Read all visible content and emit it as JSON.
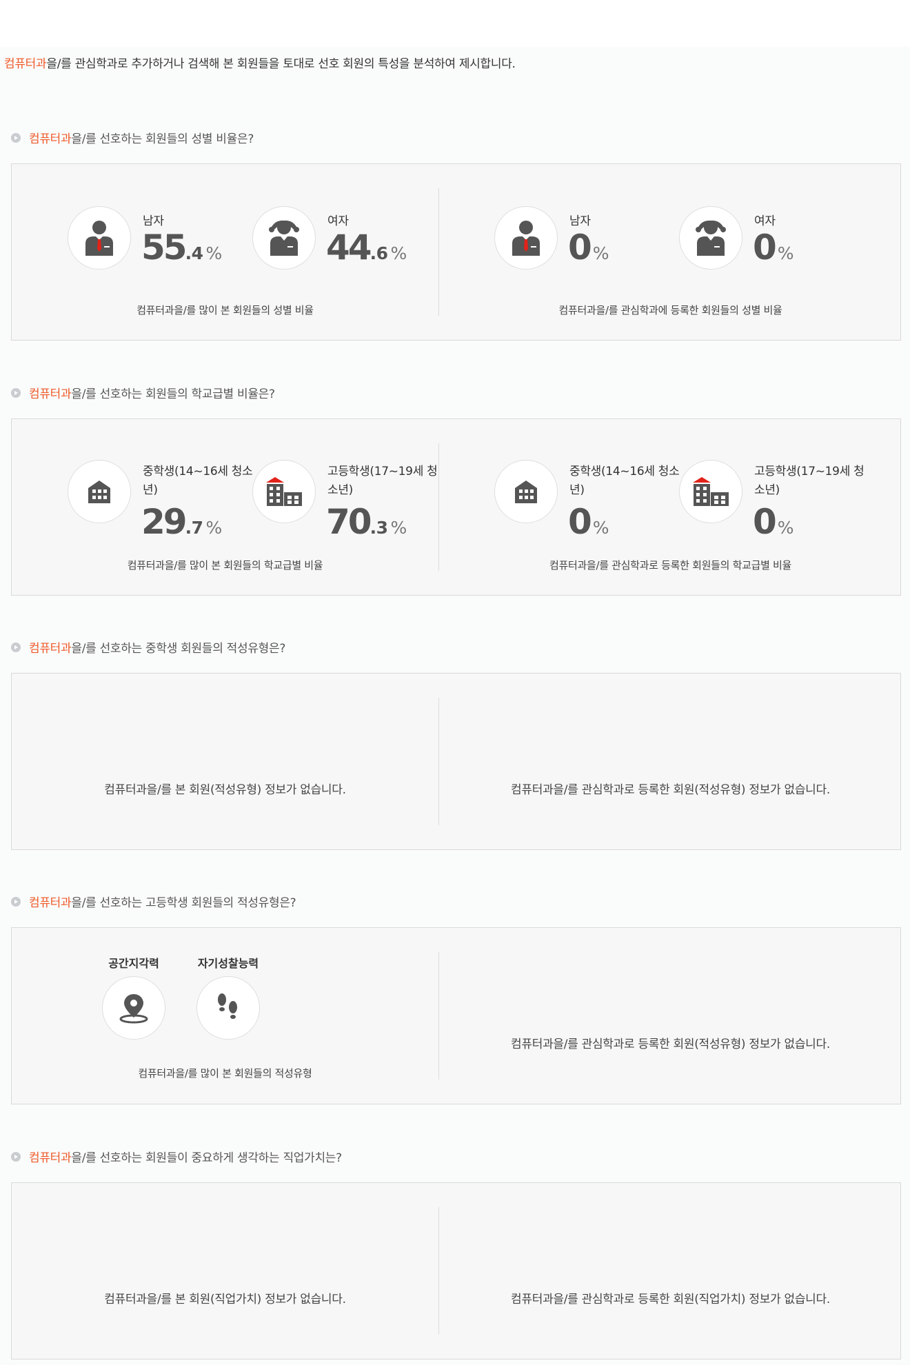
{
  "intro": {
    "highlight": "컴퓨터과",
    "text": "을/를 관심학과로 추가하거나 검색해 본 회원들을 토대로 선호 회원의 특성을 분석하여 제시합니다."
  },
  "gender": {
    "title_highlight": "컴퓨터과",
    "title_rest": "을/를 선호하는 회원들의 성별 비율은?",
    "left": {
      "male": {
        "label": "남자",
        "int": "55",
        "dec": ".4",
        "unit": "%"
      },
      "female": {
        "label": "여자",
        "int": "44",
        "dec": ".6",
        "unit": "%"
      },
      "caption": "컴퓨터과을/를 많이 본 회원들의 성별 비율"
    },
    "right": {
      "male": {
        "label": "남자",
        "int": "0",
        "dec": "",
        "unit": "%"
      },
      "female": {
        "label": "여자",
        "int": "0",
        "dec": "",
        "unit": "%"
      },
      "caption": "컴퓨터과을/를 관심학과에 등록한 회원들의 성별 비율"
    }
  },
  "school": {
    "title_highlight": "컴퓨터과",
    "title_rest": "을/를 선호하는 회원들의 학교급별 비율은?",
    "left": {
      "middle": {
        "label": "중학생(14~16세 청소년)",
        "int": "29",
        "dec": ".7",
        "unit": "%"
      },
      "high": {
        "label": "고등학생(17~19세 청소년)",
        "int": "70",
        "dec": ".3",
        "unit": "%"
      },
      "caption": "컴퓨터과을/를 많이 본 회원들의 학교급별 비율"
    },
    "right": {
      "middle": {
        "label": "중학생(14~16세 청소년)",
        "int": "0",
        "dec": "",
        "unit": "%"
      },
      "high": {
        "label": "고등학생(17~19세 청소년)",
        "int": "0",
        "dec": "",
        "unit": "%"
      },
      "caption": "컴퓨터과을/를 관심학과로 등록한 회원들의 학교급별 비율"
    }
  },
  "middle_aptitude": {
    "title_highlight": "컴퓨터과",
    "title_rest": "을/를 선호하는 중학생 회원들의 적성유형은?",
    "left_empty": "컴퓨터과을/를 본 회원(적성유형) 정보가 없습니다.",
    "right_empty": "컴퓨터과을/를 관심학과로 등록한 회원(적성유형) 정보가 없습니다."
  },
  "high_aptitude": {
    "title_highlight": "컴퓨터과",
    "title_rest": "을/를 선호하는 고등학생 회원들의 적성유형은?",
    "items": [
      {
        "label": "공간지각력",
        "icon": "location-pin-icon"
      },
      {
        "label": "자기성찰능력",
        "icon": "footprints-icon"
      }
    ],
    "caption": "컴퓨터과을/를 많이 본 회원들의 적성유형",
    "right_empty": "컴퓨터과을/를 관심학과로 등록한 회원(적성유형) 정보가 없습니다."
  },
  "job_values": {
    "title_highlight": "컴퓨터과",
    "title_rest": "을/를 선호하는 회원들이 중요하게 생각하는 직업가치는?",
    "left_empty": "컴퓨터과을/를 본 회원(직업가치) 정보가 없습니다.",
    "right_empty": "컴퓨터과을/를 관심학과로 등록한 회원(직업가치) 정보가 없습니다."
  },
  "colors": {
    "accent": "#ef5a29",
    "icon_gray": "#555555",
    "tie_red": "#e2231a"
  }
}
